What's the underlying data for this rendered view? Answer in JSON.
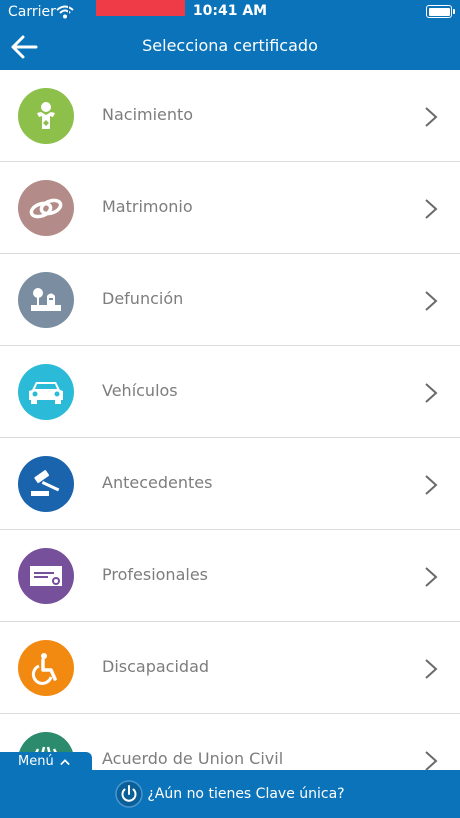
{
  "status": {
    "carrier": "Carrier",
    "time": "10:41 AM"
  },
  "nav": {
    "title": "Selecciona certificado"
  },
  "certificates": [
    {
      "label": "Nacimiento",
      "color": "#8cc04a",
      "icon": "baby-icon"
    },
    {
      "label": "Matrimonio",
      "color": "#b38b88",
      "icon": "rings-icon"
    },
    {
      "label": "Defunción",
      "color": "#7b8ea1",
      "icon": "tombstone-icon"
    },
    {
      "label": "Vehículos",
      "color": "#2bbbd8",
      "icon": "car-icon"
    },
    {
      "label": "Antecedentes",
      "color": "#1a63ad",
      "icon": "gavel-icon"
    },
    {
      "label": "Profesionales",
      "color": "#76509b",
      "icon": "diploma-icon"
    },
    {
      "label": "Discapacidad",
      "color": "#f28a12",
      "icon": "wheelchair-icon"
    },
    {
      "label": "Acuerdo de Union Civil",
      "color": "#2c8b6d",
      "icon": "union-icon"
    }
  ],
  "menu": {
    "label": "Menú"
  },
  "bottom": {
    "label": "¿Aún no tienes Clave única?"
  },
  "colors": {
    "primary": "#0b73b9",
    "row_text": "#7d7d7d",
    "divider": "#dcdcdc"
  }
}
